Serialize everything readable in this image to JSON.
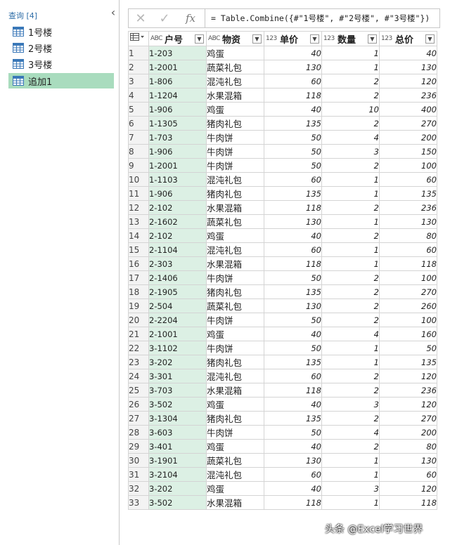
{
  "queries_pane": {
    "header": "查询 [4]",
    "collapse_glyph": "‹",
    "items": [
      {
        "label": "1号楼"
      },
      {
        "label": "2号楼"
      },
      {
        "label": "3号楼"
      },
      {
        "label": "追加1"
      }
    ],
    "selected_index": 3
  },
  "formula_bar": {
    "cancel_glyph": "✕",
    "confirm_glyph": "✓",
    "fx_label": "fx",
    "formula": "= Table.Combine({#\"1号楼\", #\"2号楼\", #\"3号楼\"})"
  },
  "grid": {
    "columns": [
      {
        "type_icon": "ABC",
        "name": "户号"
      },
      {
        "type_icon": "ABC",
        "name": "物资"
      },
      {
        "type_icon": "123",
        "name": "单价"
      },
      {
        "type_icon": "123",
        "name": "数量"
      },
      {
        "type_icon": "123",
        "name": "总价"
      }
    ],
    "rows": [
      [
        "1-203",
        "鸡蛋",
        "40",
        "1",
        "40"
      ],
      [
        "1-2001",
        "蔬菜礼包",
        "130",
        "1",
        "130"
      ],
      [
        "1-806",
        "混沌礼包",
        "60",
        "2",
        "120"
      ],
      [
        "1-1204",
        "水果混箱",
        "118",
        "2",
        "236"
      ],
      [
        "1-906",
        "鸡蛋",
        "40",
        "10",
        "400"
      ],
      [
        "1-1305",
        "猪肉礼包",
        "135",
        "2",
        "270"
      ],
      [
        "1-703",
        "牛肉饼",
        "50",
        "4",
        "200"
      ],
      [
        "1-906",
        "牛肉饼",
        "50",
        "3",
        "150"
      ],
      [
        "1-2001",
        "牛肉饼",
        "50",
        "2",
        "100"
      ],
      [
        "1-1103",
        "混沌礼包",
        "60",
        "1",
        "60"
      ],
      [
        "1-906",
        "猪肉礼包",
        "135",
        "1",
        "135"
      ],
      [
        "2-102",
        "水果混箱",
        "118",
        "2",
        "236"
      ],
      [
        "2-1602",
        "蔬菜礼包",
        "130",
        "1",
        "130"
      ],
      [
        "2-102",
        "鸡蛋",
        "40",
        "2",
        "80"
      ],
      [
        "2-1104",
        "混沌礼包",
        "60",
        "1",
        "60"
      ],
      [
        "2-303",
        "水果混箱",
        "118",
        "1",
        "118"
      ],
      [
        "2-1406",
        "牛肉饼",
        "50",
        "2",
        "100"
      ],
      [
        "2-1905",
        "猪肉礼包",
        "135",
        "2",
        "270"
      ],
      [
        "2-504",
        "蔬菜礼包",
        "130",
        "2",
        "260"
      ],
      [
        "2-2204",
        "牛肉饼",
        "50",
        "2",
        "100"
      ],
      [
        "2-1001",
        "鸡蛋",
        "40",
        "4",
        "160"
      ],
      [
        "3-1102",
        "牛肉饼",
        "50",
        "1",
        "50"
      ],
      [
        "3-202",
        "猪肉礼包",
        "135",
        "1",
        "135"
      ],
      [
        "3-301",
        "混沌礼包",
        "60",
        "2",
        "120"
      ],
      [
        "3-703",
        "水果混箱",
        "118",
        "2",
        "236"
      ],
      [
        "3-502",
        "鸡蛋",
        "40",
        "3",
        "120"
      ],
      [
        "3-1304",
        "猪肉礼包",
        "135",
        "2",
        "270"
      ],
      [
        "3-603",
        "牛肉饼",
        "50",
        "4",
        "200"
      ],
      [
        "3-401",
        "鸡蛋",
        "40",
        "2",
        "80"
      ],
      [
        "3-1901",
        "蔬菜礼包",
        "130",
        "1",
        "130"
      ],
      [
        "3-2104",
        "混沌礼包",
        "60",
        "1",
        "60"
      ],
      [
        "3-202",
        "鸡蛋",
        "40",
        "3",
        "120"
      ],
      [
        "3-502",
        "水果混箱",
        "118",
        "1",
        "118"
      ]
    ]
  },
  "watermark": "头条 @Excel学习世界",
  "colors": {
    "selected_query_bg": "#a9dcbe",
    "key_column_bg": "#dcf0e4",
    "header_link": "#2f6ea8"
  }
}
